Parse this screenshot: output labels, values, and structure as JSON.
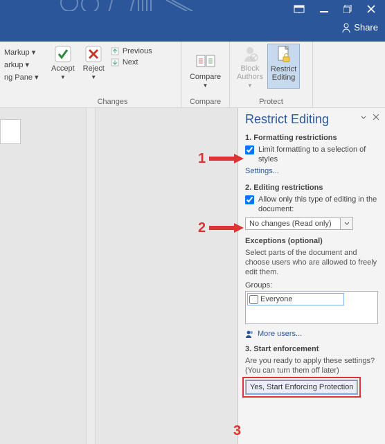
{
  "titlebar": {
    "share_label": "Share"
  },
  "ribbon": {
    "markup_item1": "Markup",
    "markup_item2": "arkup",
    "markup_item3": "ng Pane",
    "accept": "Accept",
    "reject": "Reject",
    "previous": "Previous",
    "next": "Next",
    "changes_group": "Changes",
    "compare": "Compare",
    "compare_group": "Compare",
    "block_authors": "Block\nAuthors",
    "restrict_editing": "Restrict\nEditing",
    "protect_group": "Protect"
  },
  "pane": {
    "title": "Restrict Editing",
    "s1_heading": "1. Formatting restrictions",
    "s1_checkbox": "Limit formatting to a selection of styles",
    "s1_settings": "Settings...",
    "s2_heading": "2. Editing restrictions",
    "s2_checkbox": "Allow only this type of editing in the document:",
    "s2_combo": "No changes (Read only)",
    "exc_heading": "Exceptions (optional)",
    "exc_desc": "Select parts of the document and choose users who are allowed to freely edit them.",
    "groups_label": "Groups:",
    "groups_everyone": "Everyone",
    "more_users": "More users...",
    "s3_heading": "3. Start enforcement",
    "s3_desc": "Are you ready to apply these settings? (You can turn them off later)",
    "s3_button": "Yes, Start Enforcing Protection"
  },
  "annotations": {
    "n1": "1",
    "n2": "2",
    "n3": "3"
  }
}
